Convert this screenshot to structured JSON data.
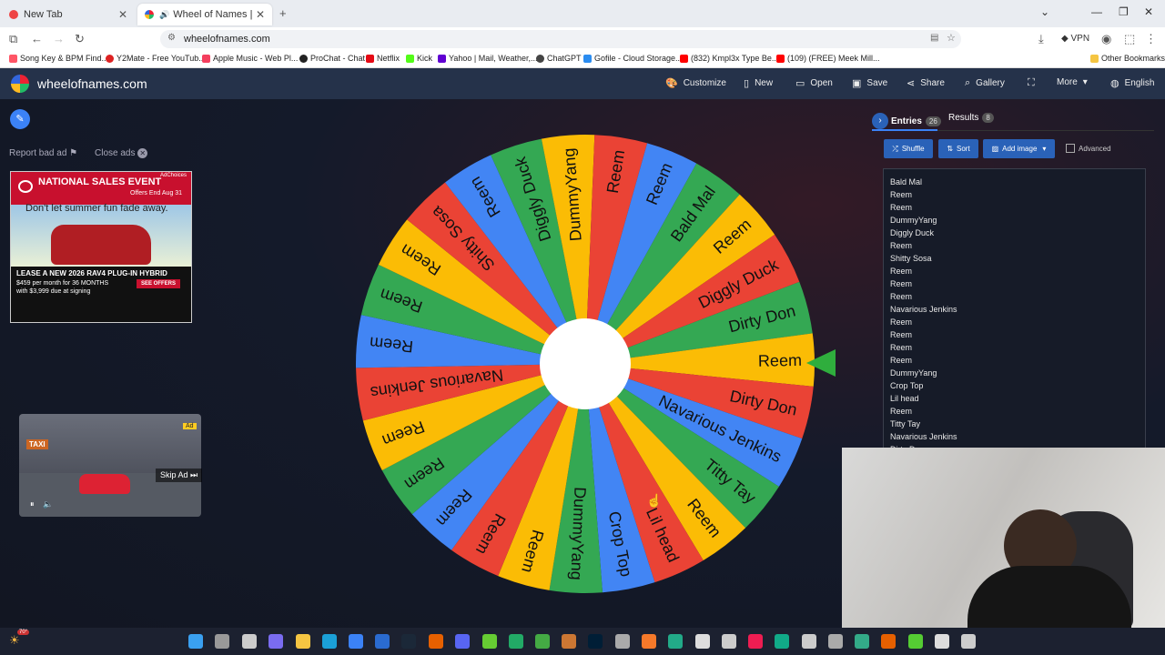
{
  "browser": {
    "tabs": [
      {
        "title": "New Tab"
      },
      {
        "title": "Wheel of Names | Random"
      }
    ],
    "new_tab_symbol": "+",
    "url": "wheelofnames.com",
    "vpn_label": "VPN",
    "bookmarks": [
      "Song Key & BPM Find...",
      "Y2Mate - Free YouTub...",
      "Apple Music - Web Pl...",
      "ProChat - Chat",
      "Netflix",
      "Kick",
      "Yahoo | Mail, Weather,...",
      "ChatGPT",
      "Gofile - Cloud Storage...",
      "(832) Kmpl3x Type Be...",
      "(109) (FREE) Meek Mill..."
    ],
    "other_bookmarks": "Other Bookmarks"
  },
  "app": {
    "logo_text": "wheelofnames.com",
    "menu": [
      {
        "label": "Customize",
        "icon": "palette-icon"
      },
      {
        "label": "New",
        "icon": "new-file-icon"
      },
      {
        "label": "Open",
        "icon": "folder-icon"
      },
      {
        "label": "Save",
        "icon": "save-icon"
      },
      {
        "label": "Share",
        "icon": "share-icon"
      },
      {
        "label": "Gallery",
        "icon": "search-icon"
      },
      {
        "label": "",
        "icon": "fullscreen-icon"
      },
      {
        "label": "More",
        "icon": "chevron-down-icon"
      },
      {
        "label": "English",
        "icon": "globe-icon"
      }
    ]
  },
  "ads": {
    "report_label": "Report bad ad",
    "close_label": "Close ads",
    "banner": {
      "adchoices": "AdChoices",
      "headline": "NATIONAL SALES EVENT",
      "offer_end": "Offers End Aug 31",
      "subhead": "Don't let summer fun fade away.",
      "lease": "LEASE A NEW 2026 RAV4 PLUG-IN HYBRID",
      "terms1": "$459 per month for 36 MONTHS",
      "terms2": "with $3,999 due at signing",
      "cta": "SEE OFFERS"
    },
    "video": {
      "ad_badge": "Ad",
      "skip_label": "Skip Ad ⏭",
      "sign": "TAXI"
    }
  },
  "wheel": {
    "segments": [
      "Dirty Don",
      "Reem",
      "Dirty Don",
      "Navarious Jenkins",
      "Titty Tay",
      "Reem",
      "Lil head",
      "Crop Top",
      "DummyYang",
      "Reem",
      "Reem",
      "Reem",
      "Reem",
      "Reem",
      "Navarious Jenkins",
      "Reem",
      "Reem",
      "Reem",
      "Shitty Sosa",
      "Reem",
      "Diggly Duck",
      "DummyYang",
      "Reem",
      "Reem",
      "Bald Mal",
      "Reem",
      "Diggly Duck"
    ],
    "colors": [
      "#34a853",
      "#fbbc05",
      "#ea4335",
      "#4285f4"
    ]
  },
  "panel": {
    "tab_entries": "Entries",
    "entries_count": "26",
    "tab_results": "Results",
    "results_count": "8",
    "shuffle": "Shuffle",
    "sort": "Sort",
    "add_image": "Add image",
    "advanced": "Advanced",
    "entries": [
      "Bald Mal",
      "Reem",
      "Reem",
      "DummyYang",
      "Diggly Duck",
      "Reem",
      "Shitty Sosa",
      "Reem",
      "Reem",
      "Reem",
      "Navarious Jenkins",
      "Reem",
      "Reem",
      "Reem",
      "Reem",
      "DummyYang",
      "Crop Top",
      "Lil head",
      "Reem",
      "Titty Tay",
      "Navarious Jenkins",
      "Dirty Don"
    ]
  },
  "taskbar": {
    "weather_temp": "70°"
  }
}
